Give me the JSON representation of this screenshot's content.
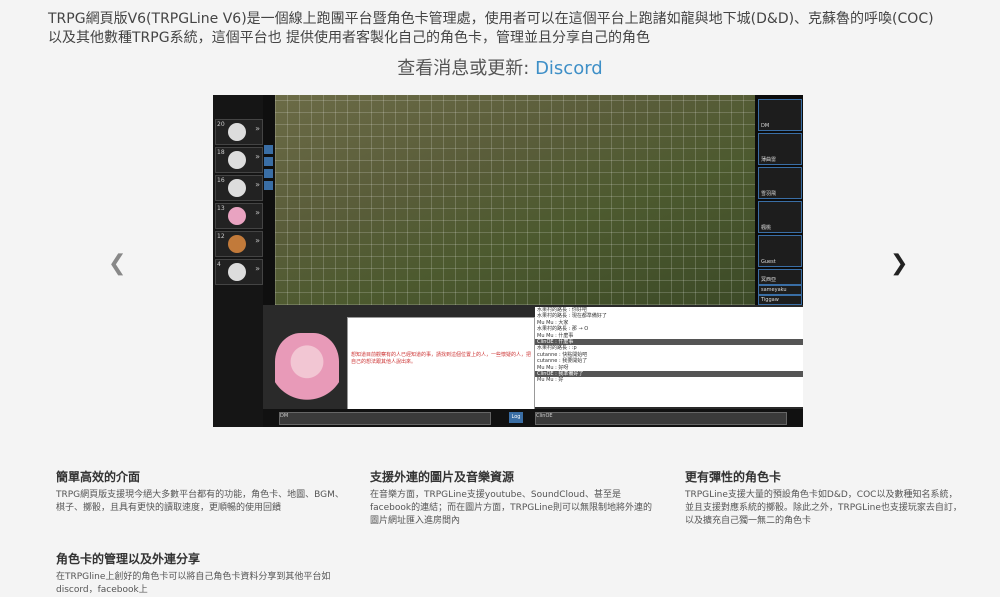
{
  "intro": {
    "line1": "TRPG網頁版V6(TRPGLine V6)是一個線上跑團平台暨角色卡管理處，使用者可以在這個平台上跑諸如龍與地下城(D&D)、克蘇魯的呼喚(COC)",
    "line2": "以及其他數種TRPG系統，這個平台也 提供使用者客製化自己的角色卡，管理並且分享自己的角色"
  },
  "news": {
    "label": "查看消息或更新:",
    "link": "Discord"
  },
  "carousel": {
    "prev_icon": "chevron-left-icon",
    "next_icon": "chevron-right-icon"
  },
  "screenshot": {
    "tokens": [
      {
        "num": "20"
      },
      {
        "num": "18"
      },
      {
        "num": "16"
      },
      {
        "num": "13"
      },
      {
        "num": "12"
      },
      {
        "num": "4"
      }
    ],
    "characters": [
      {
        "name": "DM"
      },
      {
        "name": "薄曲雷"
      },
      {
        "name": "雪羽飛"
      },
      {
        "name": "楓桃"
      },
      {
        "name": "Guest"
      },
      {
        "name": "冥西亞"
      },
      {
        "name": "sameyaku"
      },
      {
        "name": "Tiggaw"
      }
    ],
    "note_text": "想知道目前觀察有的人已經知道的事，請找到這個位置上的人，一些懷疑的人，把自己的想法跟其他人說出來。",
    "chat": [
      {
        "text": "水果村的路長 : 你好吧",
        "hl": false
      },
      {
        "text": "水果村的路長 : 現在都準備好了",
        "hl": false
      },
      {
        "text": "Mu Mu : 大家",
        "hl": false
      },
      {
        "text": "水果村的路長 : 那 → O",
        "hl": false
      },
      {
        "text": "Mu Mu : 什麼事",
        "hl": false
      },
      {
        "text": "ClinOE : 什麼事",
        "hl": true
      },
      {
        "text": "水果村的路長 : :p",
        "hl": false
      },
      {
        "text": "cutanne : 快點開始吧",
        "hl": false
      },
      {
        "text": "cutanne : 我要開始了",
        "hl": false
      },
      {
        "text": "Mu Mu : 好呀",
        "hl": false
      },
      {
        "text": "ClinOE : 我準備好了",
        "hl": true
      },
      {
        "text": "Mu Mu : 好",
        "hl": false
      }
    ],
    "input_label": "DM",
    "log_button": "Log",
    "chat_target": "ClinOE"
  },
  "features": [
    {
      "title": "簡單高效的介面",
      "body": "TRPG網頁版支援現今絕大多數平台都有的功能，角色卡、地圖、BGM、棋子、擲骰，且具有更快的讀取速度，更順暢的使用回饋"
    },
    {
      "title": "支援外連的圖片及音樂資源",
      "body": "在音樂方面，TRPGLine支援youtube、SoundCloud、甚至是facebook的連結；而在圖片方面，TRPGLine則可以無限制地將外連的圖片網址匯入進房間內"
    },
    {
      "title": "更有彈性的角色卡",
      "body": "TRPGLine支援大量的預設角色卡如D&D，COC以及數種知名系統，並且支援對應系統的擲骰。除此之外，TRPGLine也支援玩家去自訂，以及擴充自己獨一無二的角色卡"
    },
    {
      "title": "角色卡的管理以及外連分享",
      "body": "在TRPGline上創好的角色卡可以將自己角色卡資料分享到其他平台如discord，facebook上"
    }
  ]
}
